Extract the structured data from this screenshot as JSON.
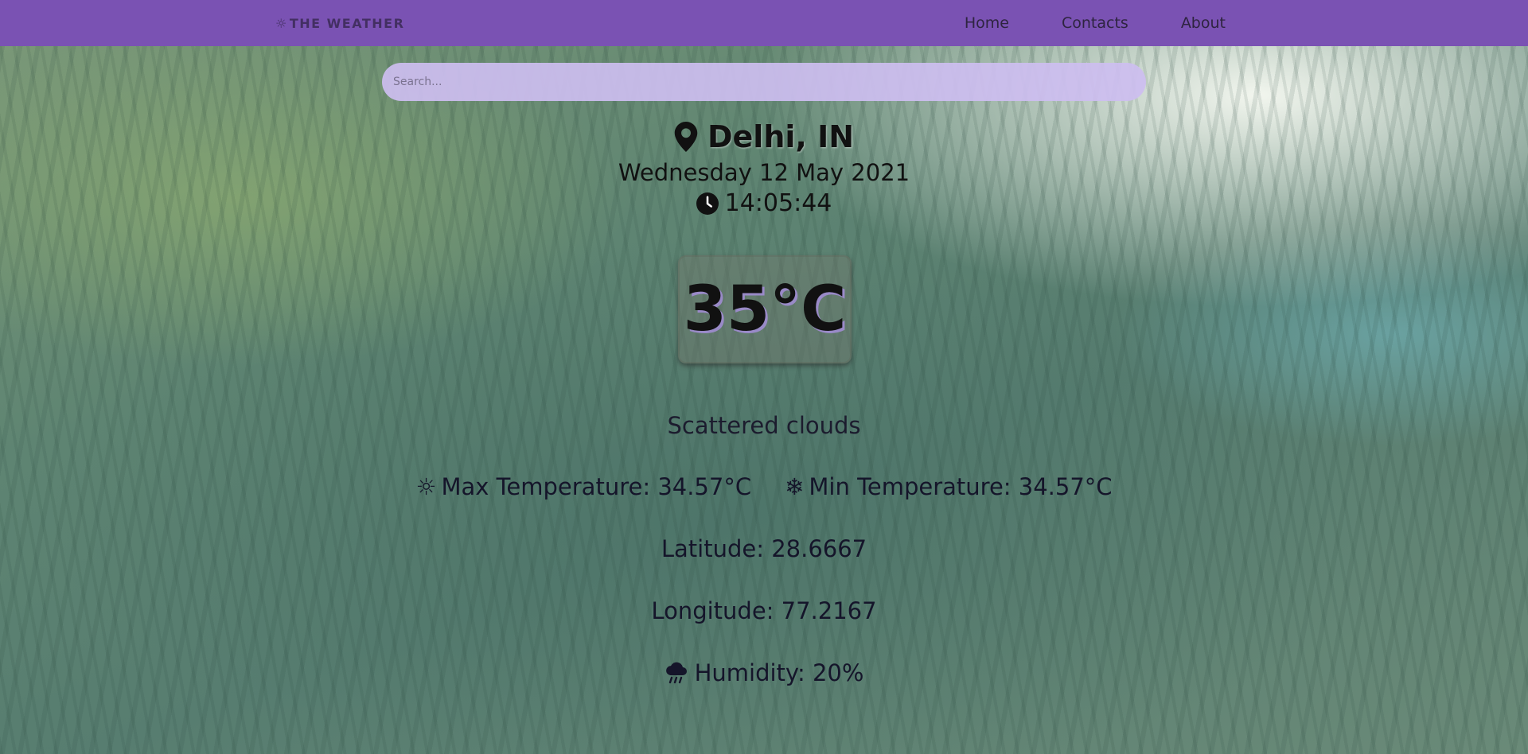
{
  "brand": {
    "icon": "sun-icon",
    "title": "THE WEATHER"
  },
  "nav": {
    "items": [
      "Home",
      "Contacts",
      "About"
    ]
  },
  "search": {
    "placeholder": "Search...",
    "value": ""
  },
  "location": {
    "icon": "map-pin-icon",
    "text": "Delhi, IN"
  },
  "date": "Wednesday 12 May 2021",
  "time": {
    "icon": "clock-icon",
    "text": "14:05:44"
  },
  "temperature": "35°C",
  "description": "Scattered clouds",
  "max_temp": {
    "icon": "sun-icon",
    "text": "Max Temperature: 34.57°C"
  },
  "min_temp": {
    "icon": "snowflake-icon",
    "text": "Min Temperature: 34.57°C"
  },
  "latitude": "Latitude: 28.6667",
  "longitude": "Longitude: 77.2167",
  "humidity": {
    "icon": "rain-cloud-icon",
    "text": "Humidity: 20%"
  },
  "colors": {
    "navbar": "#7a52b3",
    "search_bg": "#cdbef0",
    "temp_shadow": "#a08cd2"
  }
}
